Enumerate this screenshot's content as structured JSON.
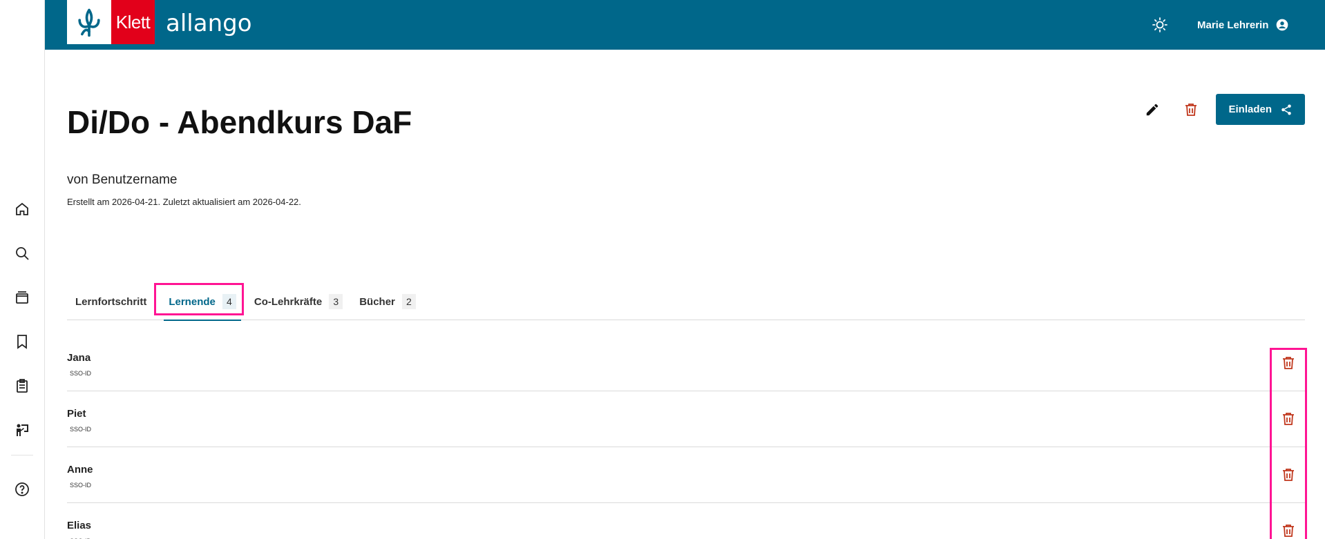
{
  "colors": {
    "brand": "#00678a",
    "klett_red": "#e2001a",
    "danger": "#c0361b",
    "highlight": "#ff1493"
  },
  "header": {
    "logo_text": "Klett",
    "app_name": "allango",
    "theme_icon": "sun-icon",
    "user_name": "Marie Lehrerin",
    "user_icon": "account-circle-icon"
  },
  "sidebar": {
    "items": [
      {
        "icon": "home-icon"
      },
      {
        "icon": "search-icon"
      },
      {
        "icon": "library-icon"
      },
      {
        "icon": "bookmark-icon"
      },
      {
        "icon": "clipboard-icon"
      },
      {
        "icon": "teacher-board-icon"
      },
      {
        "icon": "help-icon"
      }
    ]
  },
  "course": {
    "title": "Di/Do - Abendkurs DaF",
    "owner": "von Benutzername",
    "meta": "Erstellt am 2026-04-21. Zuletzt aktualisiert am 2026-04-22.",
    "edit_icon": "pencil-icon",
    "delete_icon": "trash-icon",
    "invite_label": "Einladen",
    "invite_icon": "share-icon"
  },
  "tabs": [
    {
      "label": "Lernfortschritt",
      "count": ""
    },
    {
      "label": "Lernende",
      "count": "4"
    },
    {
      "label": "Co-Lehrkräfte",
      "count": "3"
    },
    {
      "label": "Bücher",
      "count": "2"
    }
  ],
  "learners": [
    {
      "name": "Jana",
      "id": "SSO-ID"
    },
    {
      "name": "Piet",
      "id": "SSO-ID"
    },
    {
      "name": "Anne",
      "id": "SSO-ID"
    },
    {
      "name": "Elias",
      "id": "SSO-ID"
    }
  ]
}
